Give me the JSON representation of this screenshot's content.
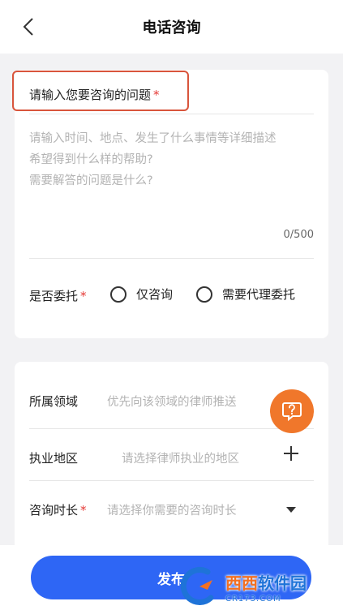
{
  "header": {
    "title": "电话咨询"
  },
  "question": {
    "label": "请输入您要咨询的问题",
    "required_mark": "*",
    "value": "",
    "placeholder_line1": "请输入时间、地点、发生了什么事情等详细描述",
    "placeholder_line2": "希望得到什么样的帮助?",
    "placeholder_line3": "需要解答的问题是什么?",
    "counter": "0/500"
  },
  "entrust": {
    "label": "是否委托",
    "required_mark": "*",
    "options": [
      "仅咨询",
      "需要代理委托"
    ]
  },
  "details": {
    "field_label": "所属领域",
    "field_placeholder": "优先向该领域的律师推送",
    "region_label": "执业地区",
    "region_placeholder": "请选择律师执业的地区",
    "duration_label": "咨询时长",
    "duration_required": "*",
    "duration_placeholder": "请选择你需要的咨询时长"
  },
  "publish_label": "发布",
  "watermark": {
    "title_part1": "西西",
    "title_part2": "软件园",
    "subtitle": "CR173.COM"
  },
  "colors": {
    "accent": "#2e66f5",
    "highlight_border": "#d9553c",
    "fab": "#f0772b",
    "required": "#e53935"
  }
}
